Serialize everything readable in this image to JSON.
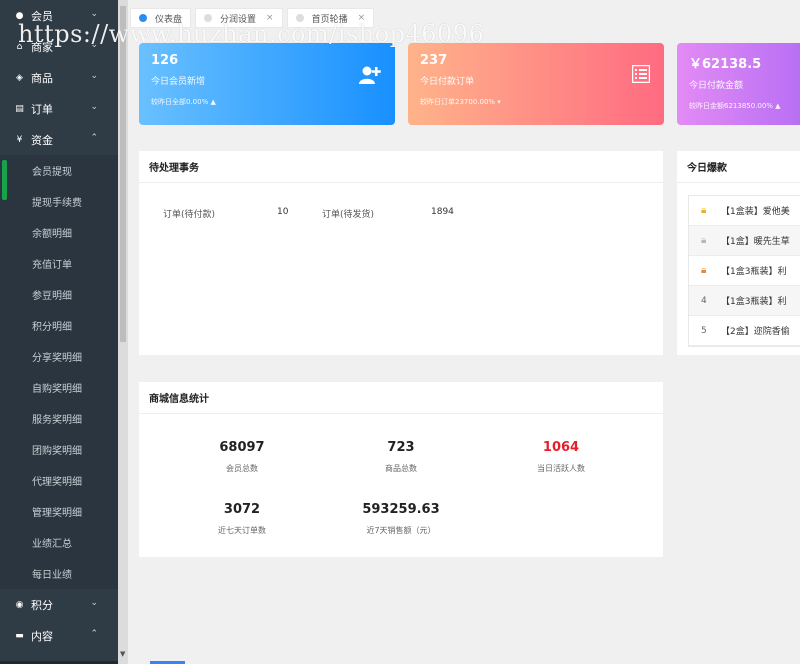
{
  "sidebar": {
    "items": [
      {
        "icon": "user-icon",
        "glyph": "👤",
        "label": "会员",
        "chevron": "⌄"
      },
      {
        "icon": "home-icon",
        "glyph": "⌂",
        "label": "商家",
        "chevron": "⌄"
      },
      {
        "icon": "tag-icon",
        "glyph": "◈",
        "label": "商品",
        "chevron": "⌄"
      },
      {
        "icon": "order-icon",
        "glyph": "▤",
        "label": "订单",
        "chevron": "⌄"
      },
      {
        "icon": "yen-icon",
        "glyph": "¥",
        "label": "资金",
        "chevron": "⌃"
      }
    ],
    "sub_items": [
      "会员提现",
      "提现手续费",
      "余额明细",
      "充值订单",
      "参豆明细",
      "积分明细",
      "分享奖明细",
      "自购奖明细",
      "服务奖明细",
      "团购奖明细",
      "代理奖明细",
      "管理奖明细",
      "业绩汇总",
      "每日业绩"
    ],
    "bottom_items": [
      {
        "icon": "points-icon",
        "glyph": "◉",
        "label": "积分",
        "chevron": "⌄"
      },
      {
        "icon": "folder-icon",
        "glyph": "▬",
        "label": "内容",
        "chevron": "⌃"
      }
    ]
  },
  "tabs": [
    {
      "label": "仪表盘",
      "active": true
    },
    {
      "label": "分润设置",
      "active": false,
      "close": "×"
    },
    {
      "label": "首页轮播",
      "active": false,
      "close": "×"
    }
  ],
  "watermark": "https://www.huzhan.com/ishop46096",
  "stats": [
    {
      "value": "126",
      "label": "今日会员新增",
      "compare": "较昨日全部0.00% ▲",
      "icon": "add-user-icon"
    },
    {
      "value": "237",
      "label": "今日付款订单",
      "compare": "较昨日订单23700.00% ▾",
      "icon": "list-icon"
    },
    {
      "value": "￥62138.5",
      "label": "今日付款金额",
      "compare": "较昨日金额6213850.00% ▲",
      "icon": "money-icon"
    }
  ],
  "todo": {
    "title": "待处理事务",
    "rows": [
      {
        "label": "订单(待付款)",
        "value": "10"
      },
      {
        "label": "订单(待发货)",
        "value": "1894"
      }
    ]
  },
  "rank": {
    "title": "今日爆款",
    "items": [
      {
        "medal": "gold",
        "no": "",
        "text": "【1盒装】爱他美"
      },
      {
        "medal": "silver",
        "no": "",
        "text": "【1盒】暖先生草"
      },
      {
        "medal": "bronze",
        "no": "",
        "text": "【1盒3瓶装】利"
      },
      {
        "medal": "",
        "no": "4",
        "text": "【1盒3瓶装】利"
      },
      {
        "medal": "",
        "no": "5",
        "text": "【2盒】迩院香偷"
      }
    ]
  },
  "shop": {
    "title": "商城信息统计",
    "metrics": [
      {
        "value": "68097",
        "label": "会员总数",
        "red": false
      },
      {
        "value": "723",
        "label": "商品总数",
        "red": false
      },
      {
        "value": "1064",
        "label": "当日活跃人数",
        "red": true
      },
      {
        "value": "3072",
        "label": "近七天订单数",
        "red": false
      },
      {
        "value": "593259.63",
        "label": "近7天销售额（元）",
        "red": false
      }
    ]
  }
}
